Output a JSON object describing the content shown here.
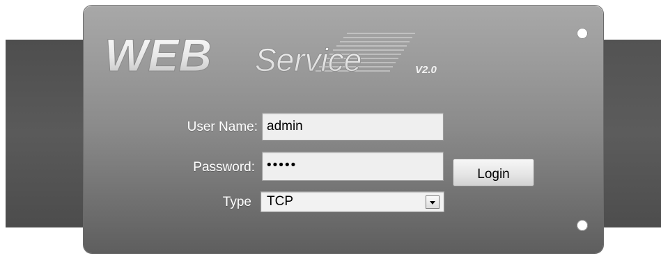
{
  "logo": {
    "main": "WEB",
    "sub": "Service",
    "version": "V2.0"
  },
  "form": {
    "username_label": "User Name:",
    "username_value": "admin",
    "password_label": "Password:",
    "password_value": "•••••",
    "type_label": "Type",
    "type_value": "TCP",
    "login_label": "Login"
  },
  "icons": {
    "dropdown": "chevron-down-icon"
  }
}
